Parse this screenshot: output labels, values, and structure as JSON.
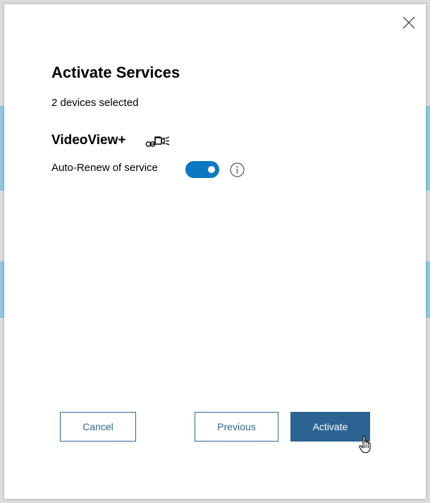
{
  "dialog": {
    "title": "Activate Services",
    "subtitle": "2 devices selected"
  },
  "service": {
    "name": "VideoView+",
    "icon": "cctv-camera-icon",
    "auto_renew_label": "Auto-Renew of service",
    "auto_renew_enabled": true,
    "info_icon": "info-icon"
  },
  "buttons": {
    "cancel": "Cancel",
    "previous": "Previous",
    "activate": "Activate"
  },
  "colors": {
    "accent": "#2b6393",
    "toggle_on": "#0a78c2"
  }
}
